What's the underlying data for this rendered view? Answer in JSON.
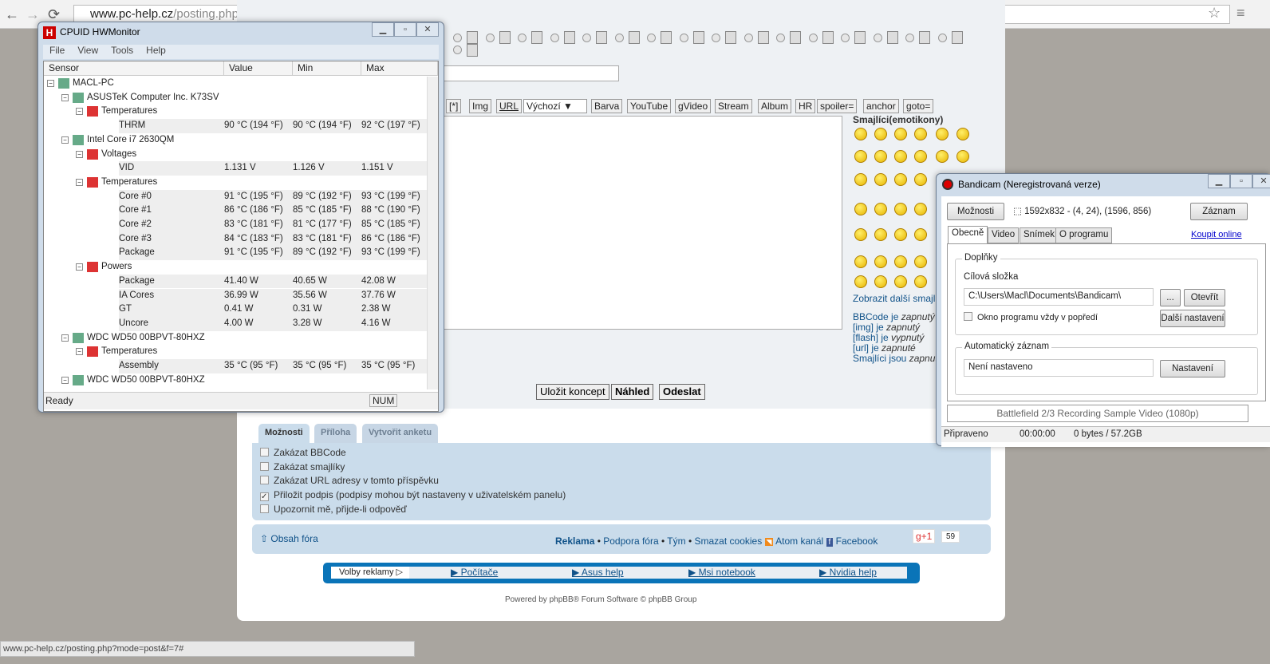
{
  "browser": {
    "url_host": "www.pc-help.cz",
    "url_path": "/posting.php?mode=post&f=7",
    "status_url": "www.pc-help.cz/posting.php?mode=post&f=7#"
  },
  "editor": {
    "bbcode_buttons": [
      "[*]",
      "Img",
      "URL",
      "Výchozí ▼",
      "Barva",
      "YouTube",
      "gVideo",
      "Stream",
      "Album",
      "HR",
      "spoiler=",
      "anchor",
      "goto="
    ],
    "smileys_title": "Smajlíci(emotikony)",
    "more_smileys": "Zobrazit další smajlíky",
    "bbinfo": [
      [
        "BBCode je ",
        "zapnutý"
      ],
      [
        "[img] je ",
        "zapnutý"
      ],
      [
        "[flash] je ",
        "vypnutý"
      ],
      [
        "[url] je ",
        "zapnuté"
      ],
      [
        "Smajlíci jsou ",
        "zapnuté"
      ]
    ],
    "buttons": {
      "save": "Uložit koncept",
      "preview": "Náhled",
      "submit": "Odeslat"
    }
  },
  "tabs": [
    "Možnosti",
    "Příloha",
    "Vytvořit anketu"
  ],
  "options": [
    {
      "label": "Zakázat BBCode",
      "checked": false
    },
    {
      "label": "Zakázat smajlíky",
      "checked": false
    },
    {
      "label": "Zakázat URL adresy v tomto příspěvku",
      "checked": false
    },
    {
      "label": "Přiložit podpis (podpisy mohou být nastaveny v uživatelském panelu)",
      "checked": true
    },
    {
      "label": "Upozornit mě, přijde-li odpověď",
      "checked": false
    }
  ],
  "footer": {
    "home": "Obsah fóra",
    "reklama": "Reklama",
    "links": [
      "Podpora fóra",
      "Tým",
      "Smazat cookies"
    ],
    "atom": "Atom kanál",
    "facebook": "Facebook",
    "gplus": "g+1",
    "gcount": "59"
  },
  "ads": {
    "label": "Volby reklamy",
    "links": [
      "Počítače",
      "Asus help",
      "Msi notebook",
      "Nvidia help"
    ]
  },
  "powered": "Powered by phpBB® Forum Software © phpBB Group",
  "hwmonitor": {
    "title": "CPUID HWMonitor",
    "menu": [
      "File",
      "View",
      "Tools",
      "Help"
    ],
    "columns": [
      "Sensor",
      "Value",
      "Min",
      "Max"
    ],
    "rows": [
      {
        "l": 0,
        "name": "MACL-PC"
      },
      {
        "l": 1,
        "name": "ASUSTeK Computer Inc. K73SV"
      },
      {
        "l": 2,
        "name": "Temperatures"
      },
      {
        "l": 3,
        "name": "THRM",
        "v": "90 °C  (194 °F)",
        "min": "90 °C  (194 °F)",
        "max": "92 °C  (197 °F)"
      },
      {
        "l": 1,
        "name": "Intel Core i7 2630QM"
      },
      {
        "l": 2,
        "name": "Voltages"
      },
      {
        "l": 3,
        "name": "VID",
        "v": "1.131 V",
        "min": "1.126 V",
        "max": "1.151 V"
      },
      {
        "l": 2,
        "name": "Temperatures"
      },
      {
        "l": 3,
        "name": "Core #0",
        "v": "91 °C  (195 °F)",
        "min": "89 °C  (192 °F)",
        "max": "93 °C  (199 °F)"
      },
      {
        "l": 3,
        "name": "Core #1",
        "v": "86 °C  (186 °F)",
        "min": "85 °C  (185 °F)",
        "max": "88 °C  (190 °F)"
      },
      {
        "l": 3,
        "name": "Core #2",
        "v": "83 °C  (181 °F)",
        "min": "81 °C  (177 °F)",
        "max": "85 °C  (185 °F)"
      },
      {
        "l": 3,
        "name": "Core #3",
        "v": "84 °C  (183 °F)",
        "min": "83 °C  (181 °F)",
        "max": "86 °C  (186 °F)"
      },
      {
        "l": 3,
        "name": "Package",
        "v": "91 °C  (195 °F)",
        "min": "89 °C  (192 °F)",
        "max": "93 °C  (199 °F)"
      },
      {
        "l": 2,
        "name": "Powers"
      },
      {
        "l": 3,
        "name": "Package",
        "v": "41.40 W",
        "min": "40.65 W",
        "max": "42.08 W"
      },
      {
        "l": 3,
        "name": "IA Cores",
        "v": "36.99 W",
        "min": "35.56 W",
        "max": "37.76 W"
      },
      {
        "l": 3,
        "name": "GT",
        "v": "0.41 W",
        "min": "0.31 W",
        "max": "2.38 W"
      },
      {
        "l": 3,
        "name": "Uncore",
        "v": "4.00 W",
        "min": "3.28 W",
        "max": "4.16 W"
      },
      {
        "l": 1,
        "name": "WDC WD50 00BPVT-80HXZ"
      },
      {
        "l": 2,
        "name": "Temperatures"
      },
      {
        "l": 3,
        "name": "Assembly",
        "v": "35 °C  (95 °F)",
        "min": "35 °C  (95 °F)",
        "max": "35 °C  (95 °F)"
      },
      {
        "l": 1,
        "name": "WDC WD50 00BPVT-80HXZ"
      }
    ],
    "status": "Ready",
    "num": "NUM"
  },
  "bandicam": {
    "title": "Bandicam (Neregistrovaná verze)",
    "options_btn": "Možnosti",
    "region": "1592x832 - (4, 24), (1596, 856)",
    "record_btn": "Záznam",
    "tabs": [
      "Obecně",
      "Video",
      "Snímek",
      "O programu"
    ],
    "buy": "Koupit online",
    "addons": "Doplňky",
    "target_label": "Cílová složka",
    "target": "C:\\Users\\Macl\\Documents\\Bandicam\\",
    "browse": "...",
    "open": "Otevřít",
    "ontop": "Okno programu vždy v popředí",
    "more": "Další nastavení",
    "auto": "Automatický záznam",
    "auto_value": "Není nastaveno",
    "auto_btn": "Nastavení",
    "banner": "Battlefield 2/3 Recording Sample Video (1080p)",
    "status": "Připraveno",
    "time": "00:00:00",
    "size": "0 bytes / 57.2GB"
  }
}
